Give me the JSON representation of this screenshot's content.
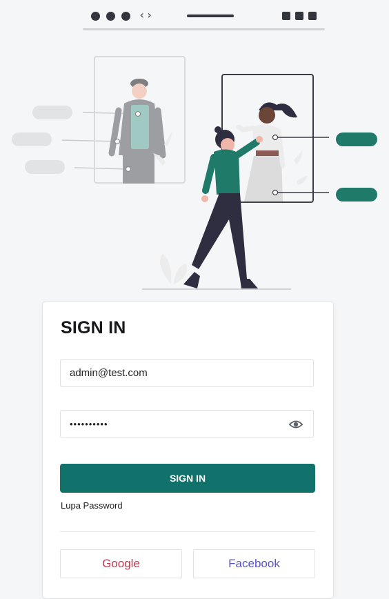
{
  "topbar": {
    "code_icon": "‹›"
  },
  "login": {
    "title": "SIGN IN",
    "email_value": "admin@test.com",
    "password_value": "••••••••••",
    "signin_label": "SIGN IN",
    "forgot_label": "Lupa Password",
    "google_label": "Google",
    "facebook_label": "Facebook"
  },
  "colors": {
    "accent": "#10726a",
    "google": "#c0394f",
    "facebook": "#5a55c9"
  },
  "icons": {
    "eye": "eye-icon",
    "code": "code-icon"
  }
}
